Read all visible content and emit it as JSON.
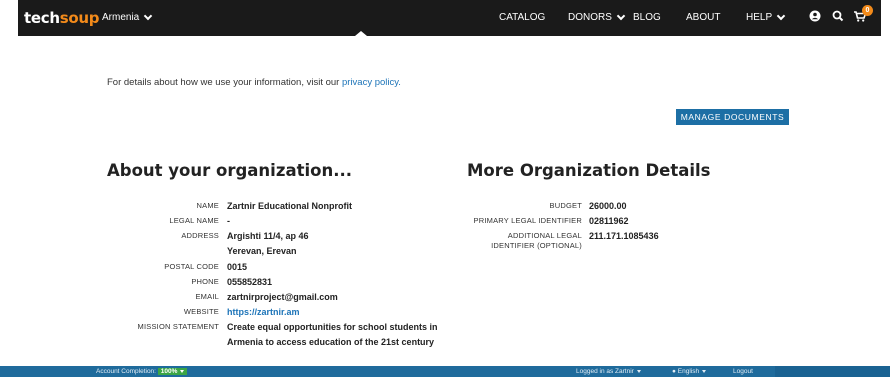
{
  "header": {
    "logo_part1": "tech",
    "logo_part2": "soup",
    "country": "Armenia",
    "nav": {
      "catalog": "CATALOG",
      "donors": "DONORS",
      "blog": "BLOG",
      "about": "ABOUT",
      "help": "HELP"
    },
    "cart_count": "0",
    "colors": {
      "bar": "#1a1a1a",
      "accent": "#f28a1a"
    }
  },
  "privacy": {
    "text": "For details about how we use your information, visit our",
    "link": "privacy policy."
  },
  "manage_documents": "MANAGE DOCUMENTS",
  "about": {
    "title": "About your organization...",
    "fields": {
      "name_label": "NAME",
      "name": "Zartnir Educational Nonprofit",
      "legal_name_label": "LEGAL NAME",
      "legal_name": "-",
      "address_label": "ADDRESS",
      "address_line1": "Argishti 11/4, ap 46",
      "address_line2": "Yerevan, Erevan",
      "postal_label": "POSTAL CODE",
      "postal": "0015",
      "phone_label": "PHONE",
      "phone": "055852831",
      "email_label": "EMAIL",
      "email": "zartnirproject@gmail.com",
      "website_label": "WEBSITE",
      "website": "https://zartnir.am",
      "mission_label": "MISSION STATEMENT",
      "mission": "Create equal opportunities for school students in Armenia to access education of the 21st century"
    }
  },
  "more": {
    "title": "More Organization Details",
    "fields": {
      "budget_label": "BUDGET",
      "budget": "26000.00",
      "primary_label": "PRIMARY LEGAL IDENTIFIER",
      "primary": "02811962",
      "additional_label": "ADDITIONAL LEGAL IDENTIFIER (OPTIONAL)",
      "additional": "211.171.1085436"
    }
  },
  "statusbar": {
    "completion_label": "Account Completion:",
    "completion_value": "100%",
    "logged_in": "Logged in as Zartnir",
    "language": "English",
    "logout": "Logout"
  }
}
